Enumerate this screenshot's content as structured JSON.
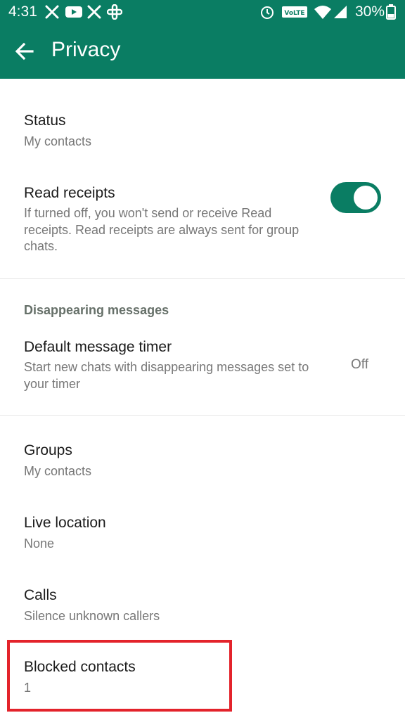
{
  "status_bar": {
    "time": "4:31",
    "notification_icons": [
      "x-icon",
      "youtube-icon",
      "x-icon",
      "slack-icon"
    ],
    "system_icons": [
      "alarm-icon",
      "volte-icon",
      "wifi-icon",
      "signal-icon"
    ],
    "volte_label": "VoLTE",
    "battery": "30%"
  },
  "app_bar": {
    "title": "Privacy",
    "background": "#0a7d63"
  },
  "settings": {
    "status": {
      "title": "Status",
      "value": "My contacts"
    },
    "read_receipts": {
      "title": "Read receipts",
      "description": "If turned off, you won't send or receive Read receipts. Read receipts are always sent for group chats.",
      "enabled": true
    },
    "disappearing": {
      "header": "Disappearing messages",
      "timer_title": "Default message timer",
      "timer_description": "Start new chats with disappearing messages set to your timer",
      "timer_value": "Off"
    },
    "groups": {
      "title": "Groups",
      "value": "My contacts"
    },
    "live_location": {
      "title": "Live location",
      "value": "None"
    },
    "calls": {
      "title": "Calls",
      "value": "Silence unknown callers"
    },
    "blocked": {
      "title": "Blocked contacts",
      "value": "1"
    }
  },
  "highlight_color": "#e3232b"
}
